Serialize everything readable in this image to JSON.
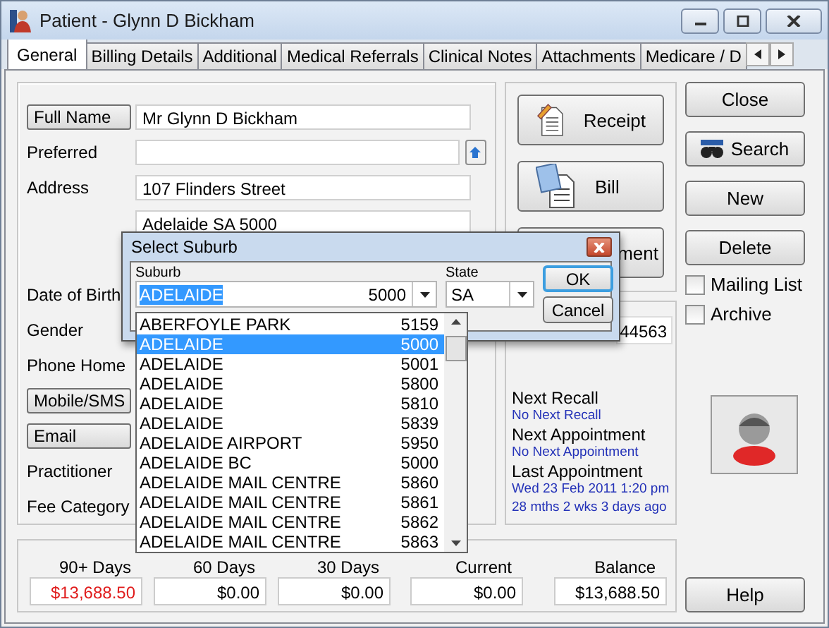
{
  "window": {
    "title": "Patient - Glynn D Bickham"
  },
  "tabs": [
    {
      "label": "General",
      "selected": true
    },
    {
      "label": "Billing Details",
      "selected": false
    },
    {
      "label": "Additional",
      "selected": false
    },
    {
      "label": "Medical Referrals",
      "selected": false
    },
    {
      "label": "Clinical Notes",
      "selected": false
    },
    {
      "label": "Attachments",
      "selected": false
    },
    {
      "label": "Medicare / D",
      "selected": false
    }
  ],
  "details": [
    {
      "label": "Full Name",
      "kind": "button",
      "value": "Mr Glynn D Bickham"
    },
    {
      "label": "Preferred",
      "kind": "label",
      "blank_field": true,
      "up_button": true
    },
    {
      "label": "Address",
      "kind": "label",
      "value": "107 Flinders Street"
    },
    {
      "kind": "continuation",
      "value": "Adelaide SA 5000"
    },
    {
      "label": "Date of Birth",
      "kind": "label"
    },
    {
      "label": "Gender",
      "kind": "label"
    },
    {
      "label": "Phone Home",
      "kind": "label"
    },
    {
      "label": "Mobile/SMS",
      "kind": "button"
    },
    {
      "label": "Email",
      "kind": "button"
    },
    {
      "label": "Practitioner",
      "kind": "label"
    },
    {
      "label": "Fee Category",
      "kind": "label"
    }
  ],
  "action_buttons": [
    {
      "label": "Receipt",
      "kind": "receipt"
    },
    {
      "label": "Bill",
      "kind": "bill"
    },
    {
      "label": "ment",
      "kind": "hidden-icon"
    }
  ],
  "phone_fragment": "44563",
  "appointments": [
    {
      "heading": "Next Recall",
      "details": [
        "No Next Recall"
      ]
    },
    {
      "heading": "Next Appointment",
      "details": [
        "No Next Appointment"
      ]
    },
    {
      "heading": "Last Appointment",
      "details": [
        "Wed 23 Feb 2011 1:20 pm",
        "28 mths 2 wks 3 days ago"
      ]
    }
  ],
  "side_buttons": [
    {
      "label": "Close",
      "kind": "plain"
    },
    {
      "label": "Search",
      "kind": "search"
    },
    {
      "label": "New",
      "kind": "plain"
    },
    {
      "label": "Delete",
      "kind": "plain"
    }
  ],
  "checkboxes": [
    {
      "label": "Mailing List",
      "checked": false
    },
    {
      "label": "Archive",
      "checked": false
    }
  ],
  "totals": [
    {
      "label": "90+ Days",
      "value": "$13,688.50",
      "overdue": true
    },
    {
      "label": "60 Days",
      "value": "$0.00",
      "overdue": false
    },
    {
      "label": "30 Days",
      "value": "$0.00",
      "overdue": false
    },
    {
      "label": "Current",
      "value": "$0.00",
      "overdue": false
    },
    {
      "label": "Balance",
      "value": "$13,688.50",
      "overdue": false
    }
  ],
  "help_button": "Help",
  "dialog": {
    "title": "Select Suburb",
    "suburb_label": "Suburb",
    "suburb": "ADELAIDE",
    "postcode": "5000",
    "state_label": "State",
    "state": "SA",
    "buttons": [
      {
        "label": "OK",
        "default": true
      },
      {
        "label": "Cancel",
        "default": false
      }
    ],
    "suburbs": [
      {
        "name": "ABERFOYLE PARK",
        "postcode": "5159",
        "selected": false
      },
      {
        "name": "ADELAIDE",
        "postcode": "5000",
        "selected": true
      },
      {
        "name": "ADELAIDE",
        "postcode": "5001",
        "selected": false
      },
      {
        "name": "ADELAIDE",
        "postcode": "5800",
        "selected": false
      },
      {
        "name": "ADELAIDE",
        "postcode": "5810",
        "selected": false
      },
      {
        "name": "ADELAIDE",
        "postcode": "5839",
        "selected": false
      },
      {
        "name": "ADELAIDE AIRPORT",
        "postcode": "5950",
        "selected": false
      },
      {
        "name": "ADELAIDE BC",
        "postcode": "5000",
        "selected": false
      },
      {
        "name": "ADELAIDE MAIL CENTRE",
        "postcode": "5860",
        "selected": false
      },
      {
        "name": "ADELAIDE MAIL CENTRE",
        "postcode": "5861",
        "selected": false
      },
      {
        "name": "ADELAIDE MAIL CENTRE",
        "postcode": "5862",
        "selected": false
      },
      {
        "name": "ADELAIDE MAIL CENTRE",
        "postcode": "5863",
        "selected": false
      }
    ]
  }
}
